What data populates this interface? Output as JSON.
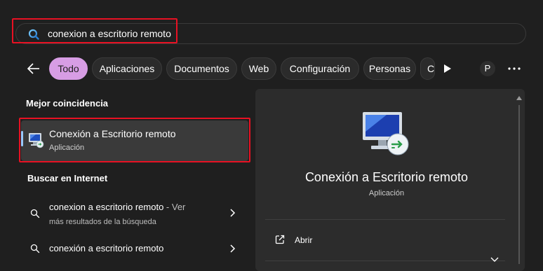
{
  "search": {
    "value": "conexion a escritorio remoto"
  },
  "filters": {
    "tabs": [
      {
        "label": "Todo",
        "active": true
      },
      {
        "label": "Aplicaciones"
      },
      {
        "label": "Documentos"
      },
      {
        "label": "Web"
      },
      {
        "label": "Configuración"
      },
      {
        "label": "Personas"
      },
      {
        "label": "C"
      }
    ],
    "avatar_letter": "P"
  },
  "best_match": {
    "heading": "Mejor coincidencia",
    "title": "Conexión a Escritorio remoto",
    "subtitle": "Aplicación"
  },
  "web_search": {
    "heading": "Buscar en Internet",
    "results": [
      {
        "text": "conexion a escritorio remoto",
        "suffix": " - Ver",
        "line2": "más resultados de la búsqueda"
      },
      {
        "text": "conexión a escritorio remoto"
      }
    ]
  },
  "detail": {
    "title": "Conexión a Escritorio remoto",
    "subtitle": "Aplicación",
    "actions": [
      {
        "label": "Abrir",
        "icon": "open-external-icon"
      }
    ]
  },
  "colors": {
    "background": "#1f1f1f",
    "active_pill": "#d79de4",
    "highlight_border": "#e81123",
    "panel": "#2c2c2c"
  }
}
